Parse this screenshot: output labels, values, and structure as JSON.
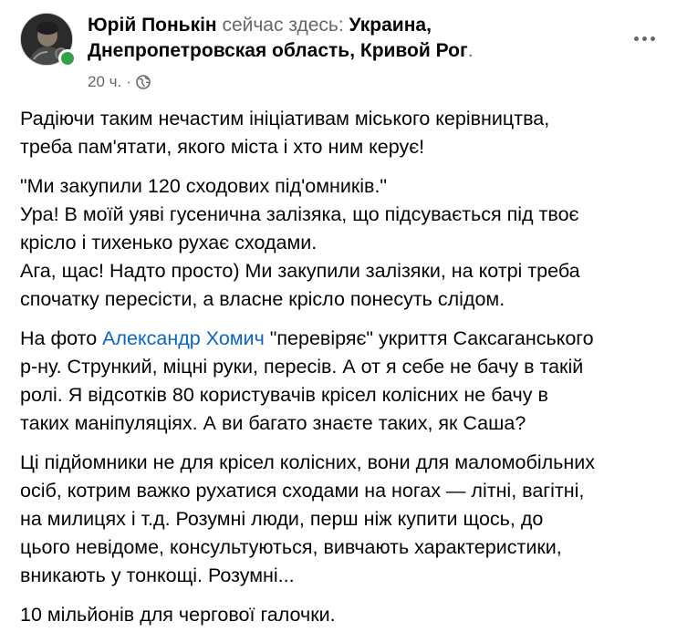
{
  "post": {
    "author": "Юрій Понькін",
    "is_here_text": " сейчас здесь: ",
    "location": "Украина, Днепропетровская область, Кривой Рог",
    "location_suffix": ".",
    "timestamp": "20 ч.",
    "separator": "·",
    "audience_icon": "globe-icon",
    "more_icon": "more-options-icon",
    "online": true,
    "colors": {
      "online": "#31a24c",
      "mention": "#0a66c2",
      "meta": "#65676b",
      "text": "#050505"
    }
  },
  "body": {
    "p1": "Радіючи таким нечастим ініціативам міського керівництва,\nтреба пам'ятати, якого міста і хто ним керує!",
    "p2": "\"Ми закупили 120 сходових під'омників.\"\nУра! В моїй уяві гусенична залізяка, що підсувається під твоє\nкрісло і тихенько рухає сходами.\nАга, щас! Надто просто) Ми закупили залізяки, на котрі треба\nспочатку пересісти, а власне крісло понесуть слідом.",
    "p3_before": "На фото ",
    "p3_mention": "Александр Хомич",
    "p3_after": " \"перевіряє\" укриття Саксаганського\nр-ну. Стрункий, міцні руки, пересів. А от я себе не бачу в такій\nролі. Я відсотків 80 користувачів крісел колісних не бачу в\nтаких маніпуляціях. А ви багато знаєте таких, як Саша?",
    "p4": "Ці підйомники не для крісел колісних, вони для маломобільних\nосіб, котрим важко рухатися сходами на ногах — літні, вагітні,\nна милицях і т.д. Розумні люди, перш ніж купити щось, до\nцього невідоме, консультуються, вивчають характеристики,\nвникають у тонкощі. Розумні...",
    "p5": "10 мільйонів для чергової галочки."
  }
}
